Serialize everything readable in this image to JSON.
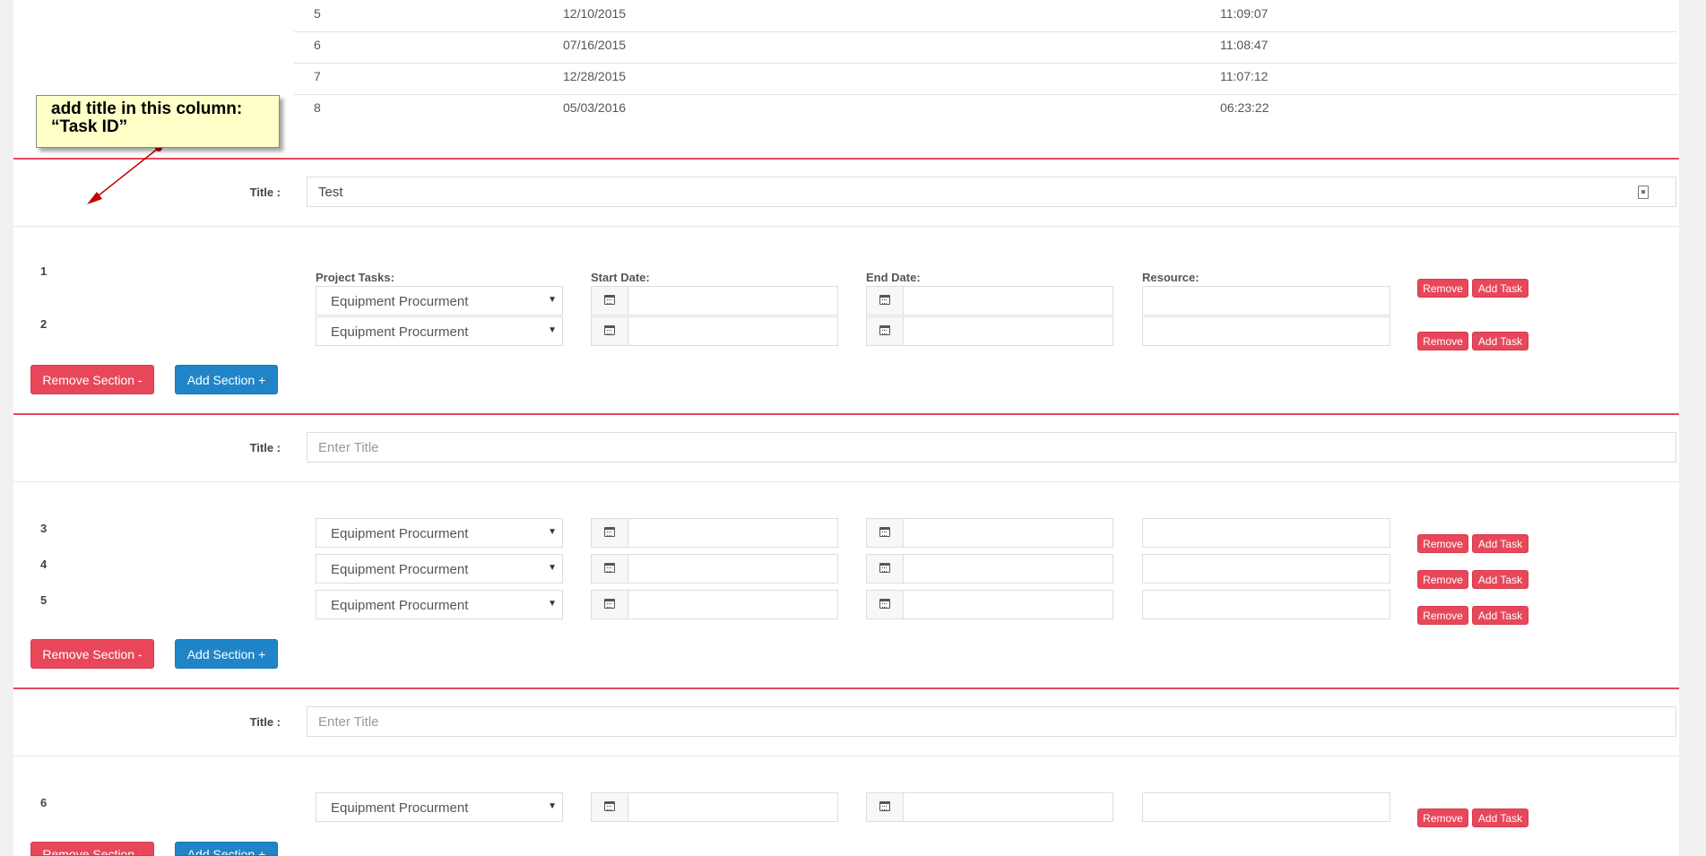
{
  "history_rows": [
    {
      "num": "5",
      "date": "12/10/2015",
      "time": "11:09:07"
    },
    {
      "num": "6",
      "date": "07/16/2015",
      "time": "11:08:47"
    },
    {
      "num": "7",
      "date": "12/28/2015",
      "time": "11:07:12"
    },
    {
      "num": "8",
      "date": "05/03/2016",
      "time": "06:23:22"
    }
  ],
  "annotation": {
    "line1": "add title in this column:",
    "line2": "“Task ID”"
  },
  "labels": {
    "title": "Title :",
    "project_tasks": "Project Tasks:",
    "start_date": "Start Date:",
    "end_date": "End Date:",
    "resource": "Resource:",
    "remove": "Remove",
    "add_task": "Add Task",
    "remove_section": "Remove Section -",
    "add_section": "Add Section +"
  },
  "sections": [
    {
      "title_value": "Test",
      "title_placeholder": "",
      "task_ids": [
        "1",
        "2"
      ]
    },
    {
      "title_value": "",
      "title_placeholder": "Enter Title",
      "task_ids": [
        "3",
        "4",
        "5"
      ]
    },
    {
      "title_value": "",
      "title_placeholder": "Enter Title",
      "task_ids": [
        "6"
      ]
    }
  ],
  "task_select_value": "Equipment Procurment",
  "colors": {
    "danger": "#e8475a",
    "primary": "#1f85c8"
  }
}
